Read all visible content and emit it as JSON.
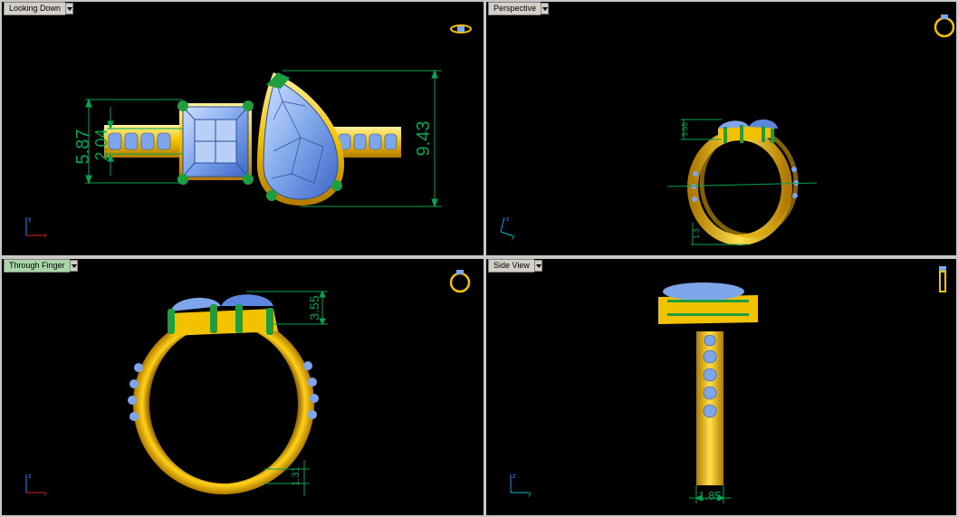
{
  "viewports": {
    "top_left": {
      "title": "Looking Down",
      "dims": {
        "overall_height": "5.87",
        "inner_height": "2.04",
        "pear_length": "9.43"
      },
      "axes": {
        "vertical": "y",
        "horizontal": "x"
      }
    },
    "top_right": {
      "title": "Perspective",
      "dims": {
        "setting_height": "3.55",
        "band_thickness": "1.3"
      },
      "axes": {
        "vertical": "z",
        "horizontal": "y"
      }
    },
    "bottom_left": {
      "title": "Through Finger",
      "dims": {
        "setting_height": "3.55",
        "band_thickness": "1.31"
      },
      "axes": {
        "vertical": "z",
        "horizontal": "x"
      }
    },
    "bottom_right": {
      "title": "Side View",
      "dims": {
        "band_width": "1.85"
      },
      "axes": {
        "vertical": "z",
        "horizontal": "y"
      }
    }
  },
  "active_viewport": "bottom_left",
  "colors": {
    "gold": "#f2c200",
    "gold_dark": "#c48a00",
    "gem": "#7fa6ea",
    "gem_dark": "#3d66c8",
    "prong": "#1e9e3e",
    "dimension": "#00a651"
  }
}
